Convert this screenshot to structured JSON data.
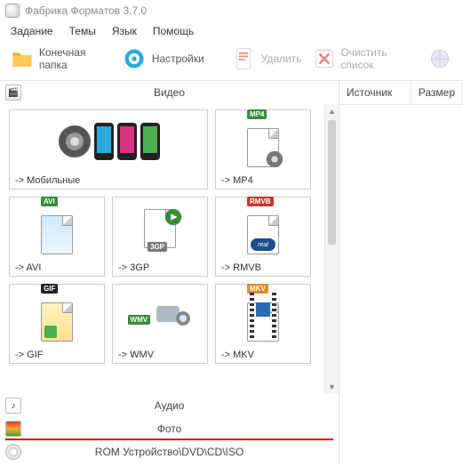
{
  "app": {
    "title": "Фабрика Форматов 3.7.0"
  },
  "menu": {
    "task": "Задание",
    "themes": "Темы",
    "language": "Язык",
    "help": "Помощь"
  },
  "toolbar": {
    "dest_folder": "Конечная папка",
    "settings": "Настройки",
    "delete": "Удалить",
    "clear_list": "Очистить список"
  },
  "sections": {
    "video": "Видео",
    "audio": "Аудио",
    "photo": "Фото",
    "rom": "ROM Устройство\\DVD\\CD\\ISO"
  },
  "right": {
    "col_source": "Источник",
    "col_size": "Размер"
  },
  "formats": {
    "mobile": {
      "label": "->  Мобильные"
    },
    "mp4": {
      "label": "->  MP4",
      "badge": "MP4"
    },
    "avi": {
      "label": "->  AVI",
      "badge": "AVI"
    },
    "gp3": {
      "label": "->  3GP",
      "badge": "3GP"
    },
    "rmvb": {
      "label": "->  RMVB",
      "badge": "RMVB"
    },
    "gif": {
      "label": "->  GIF",
      "badge": "GIF"
    },
    "wmv": {
      "label": "->  WMV",
      "badge": "WMV"
    },
    "mkv": {
      "label": "->  MKV",
      "badge": "MKV"
    }
  }
}
